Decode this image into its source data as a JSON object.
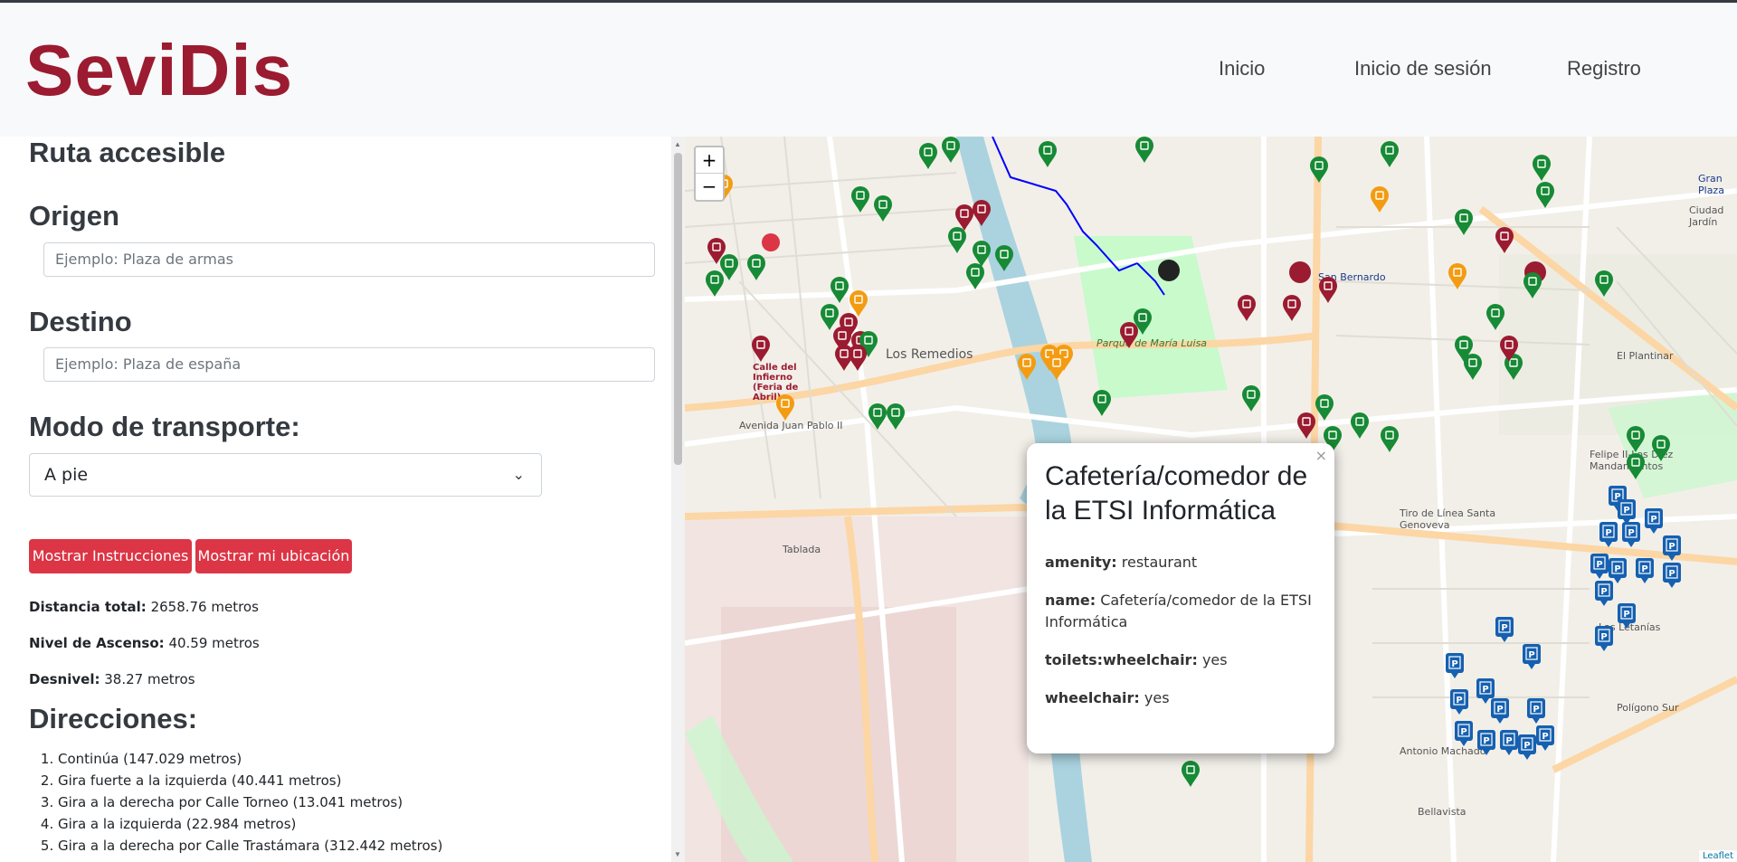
{
  "brand": "SeviDis",
  "nav": {
    "inicio": "Inicio",
    "login": "Inicio de sesión",
    "register": "Registro"
  },
  "sidebar": {
    "title": "Ruta accesible",
    "origin_label": "Origen",
    "origin_placeholder": "Ejemplo: Plaza de armas",
    "destination_label": "Destino",
    "destination_placeholder": "Ejemplo: Plaza de españa",
    "transport_label": "Modo de transporte:",
    "transport_value": "A pie",
    "btn_instructions": "Mostrar Instrucciones",
    "btn_location": "Mostrar mi ubicación",
    "stats": [
      {
        "label": "Distancia total:",
        "value": "2658.76 metros"
      },
      {
        "label": "Nivel de Ascenso:",
        "value": "40.59 metros"
      },
      {
        "label": "Desnivel:",
        "value": "38.27 metros"
      }
    ],
    "directions_title": "Direcciones:",
    "directions": [
      "Continúa (147.029 metros)",
      "Gira fuerte a la izquierda (40.441 metros)",
      "Gira a la derecha por Calle Torneo (13.041 metros)",
      "Gira a la izquierda (22.984 metros)",
      "Gira a la derecha por Calle Trastámara (312.442 metros)"
    ]
  },
  "map": {
    "zoom_in": "+",
    "zoom_out": "−",
    "attribution": "Leaflet",
    "labels": [
      "Los Remedios",
      "Parque de María Luisa",
      "San Bernardo",
      "El Plantinar",
      "Tiro de Línea Santa Genoveva",
      "Felipe II-Los Diez Mandamientos",
      "Polígono Sur",
      "Antonio Machado",
      "Bellavista",
      "Tablada",
      "Calle del Infierno (Feria de Abril)",
      "Avenida Juan Pablo II",
      "Las Letanías",
      "Gran Plaza",
      "Ciudad Jardín"
    ],
    "popup": {
      "title": "Cafetería/comedor de la ETSI Informática",
      "close": "×",
      "fields": [
        {
          "key": "amenity:",
          "value": "restaurant"
        },
        {
          "key": "name:",
          "value": "Cafetería/comedor de la ETSI Informática"
        },
        {
          "key": "toilets:wheelchair:",
          "value": "yes"
        },
        {
          "key": "wheelchair:",
          "value": "yes"
        }
      ]
    },
    "colors": {
      "route": "#0000ff",
      "marker_green": "#178a35",
      "marker_red": "#9b1b30",
      "marker_orange": "#f39c12",
      "marker_blue": "#1560b0",
      "river": "#aad3df",
      "park": "#c8facc"
    }
  }
}
